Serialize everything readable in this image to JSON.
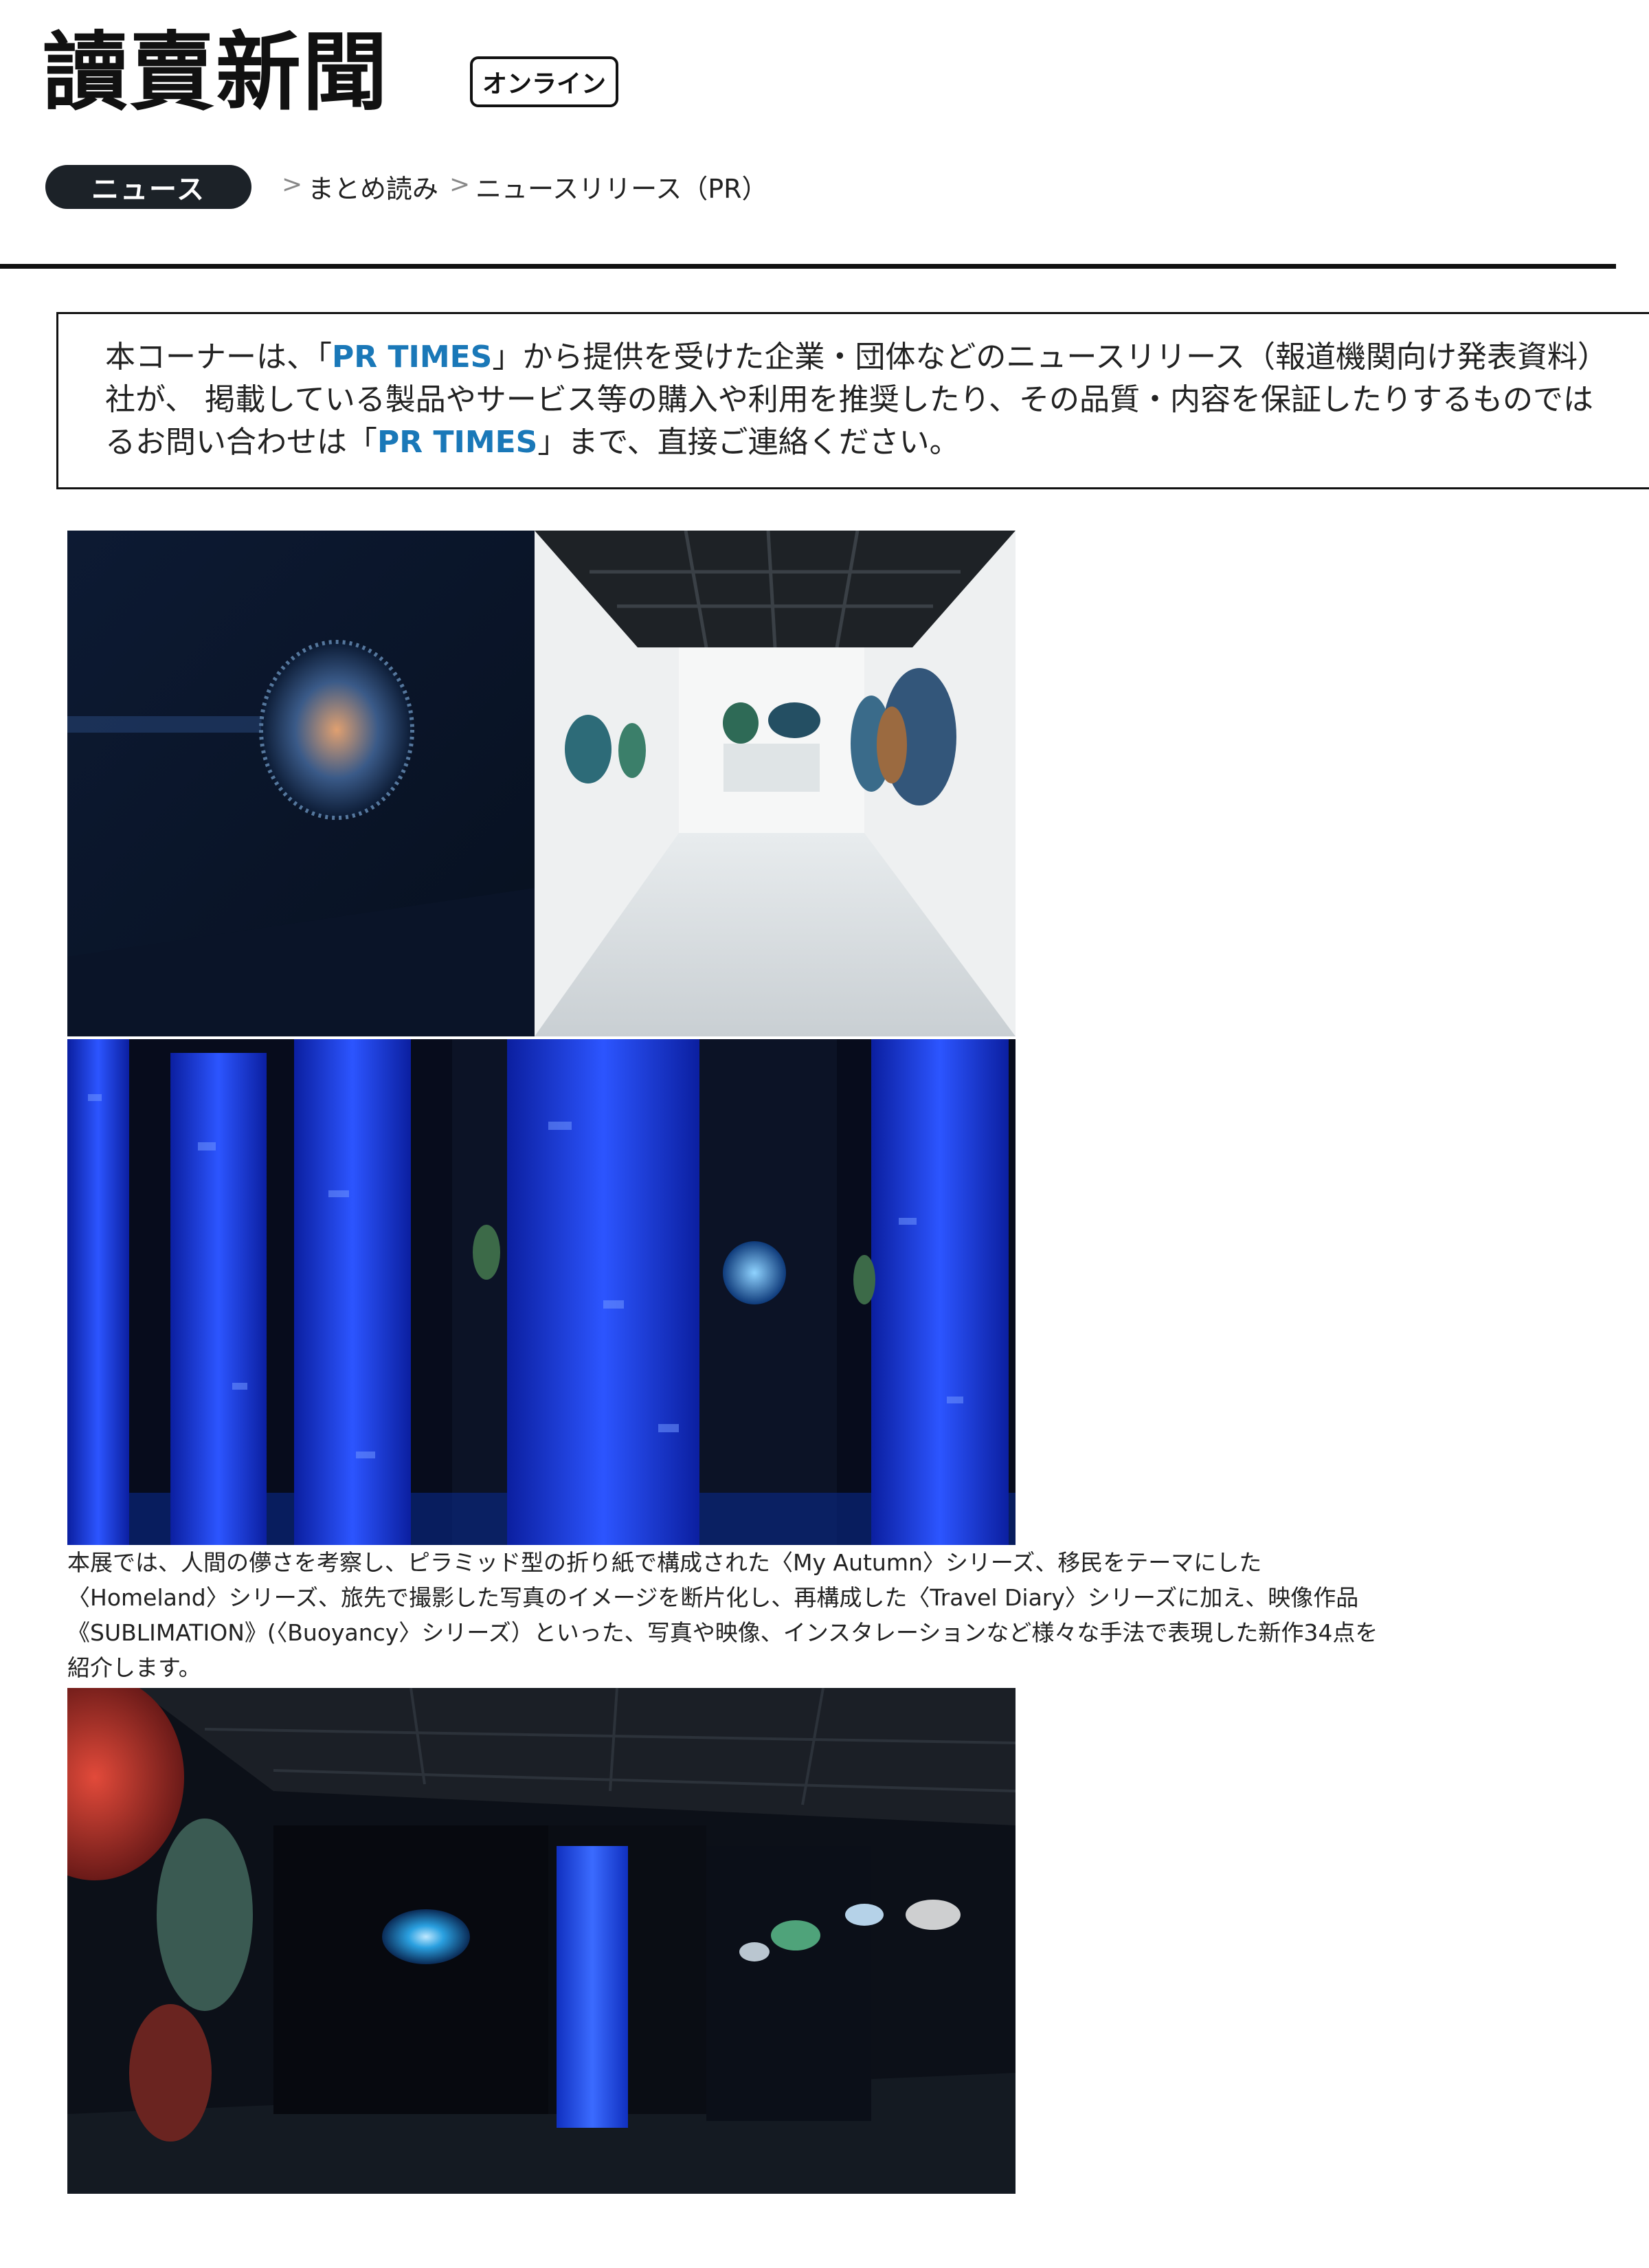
{
  "header": {
    "logo_text": "讀賣新聞",
    "online_badge": "オンライン"
  },
  "breadcrumb": {
    "section": "ニュース",
    "separator": ">",
    "items": [
      "まとめ読み",
      "ニュースリリース（PR）"
    ]
  },
  "notice": {
    "line1_pre": "本コーナーは、「",
    "line1_pr": "PR TIMES",
    "line1_post": "」から提供を受けた企業・団体などのニュースリリース（報道機関向け発表資料）",
    "line2": "社が、 掲載している製品やサービス等の購入や利用を推奨したり、その品質・内容を保証したりするものでは",
    "line3_pre": "るお問い合わせは「",
    "line3_pr": "PR TIMES",
    "line3_post": "」まで、直接ご連絡ください。"
  },
  "article": {
    "photos": [
      "exhibition-corridor-photo",
      "blue-columns-installation-photo",
      "dark-gallery-photo"
    ],
    "description": [
      "本展では、人間の儚さを考察し、ピラミッド型の折り紙で構成された〈My Autumn〉シリーズ、移民をテーマにした",
      "〈Homeland〉シリーズ、旅先で撮影した写真のイメージを断片化し、再構成した〈Travel Diary〉シリーズに加え、映像作品",
      "《SUBLIMATION》(〈Buoyancy〉シリーズ）といった、写真や映像、インスタレーションなど様々な手法で表現した新作34点を",
      "紹介します。"
    ]
  },
  "colors": {
    "pr_link": "#1a78b8",
    "pill_bg": "#1c2228",
    "installation_blue": "#1a3fd6"
  }
}
